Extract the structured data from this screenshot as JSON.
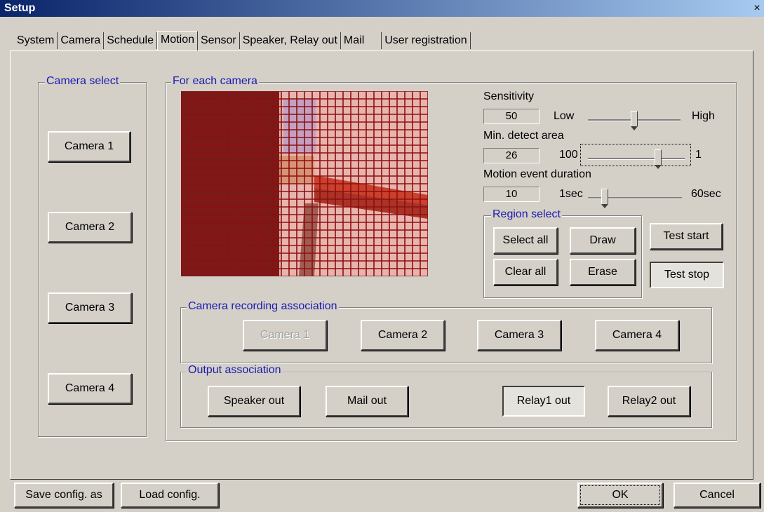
{
  "window": {
    "title": "Setup",
    "close_glyph": "×"
  },
  "tabs": [
    {
      "label": "System"
    },
    {
      "label": "Camera"
    },
    {
      "label": "Schedule"
    },
    {
      "label": "Motion",
      "active": true
    },
    {
      "label": "Sensor"
    },
    {
      "label": "Speaker, Relay out"
    },
    {
      "label": "Mail"
    },
    {
      "label": "User registration"
    }
  ],
  "camera_select": {
    "label": "Camera select",
    "buttons": [
      "Camera 1",
      "Camera 2",
      "Camera 3",
      "Camera 4"
    ]
  },
  "for_each_camera": {
    "label": "For each camera",
    "sensitivity": {
      "label": "Sensitivity",
      "value": "50",
      "low": "Low",
      "high": "High",
      "level": 0.5
    },
    "min_detect": {
      "label": "Min. detect area",
      "value": "26",
      "low": "100",
      "high": "1",
      "level": 0.74
    },
    "duration": {
      "label": "Motion event duration",
      "value": "10",
      "low": "1sec",
      "high": "60sec",
      "level": 0.15
    },
    "region_select": {
      "label": "Region select",
      "select_all": "Select all",
      "draw": "Draw",
      "clear_all": "Clear all",
      "erase": "Erase"
    },
    "test_start": "Test start",
    "test_stop": "Test stop"
  },
  "recording_assoc": {
    "label": "Camera recording association",
    "buttons": [
      "Camera 1",
      "Camera 2",
      "Camera 3",
      "Camera 4"
    ]
  },
  "output_assoc": {
    "label": "Output association",
    "speaker": "Speaker out",
    "mail": "Mail out",
    "relay1": "Relay1 out",
    "relay2": "Relay2 out"
  },
  "footer": {
    "save": "Save config. as",
    "load": "Load config.",
    "ok": "OK",
    "cancel": "Cancel"
  }
}
